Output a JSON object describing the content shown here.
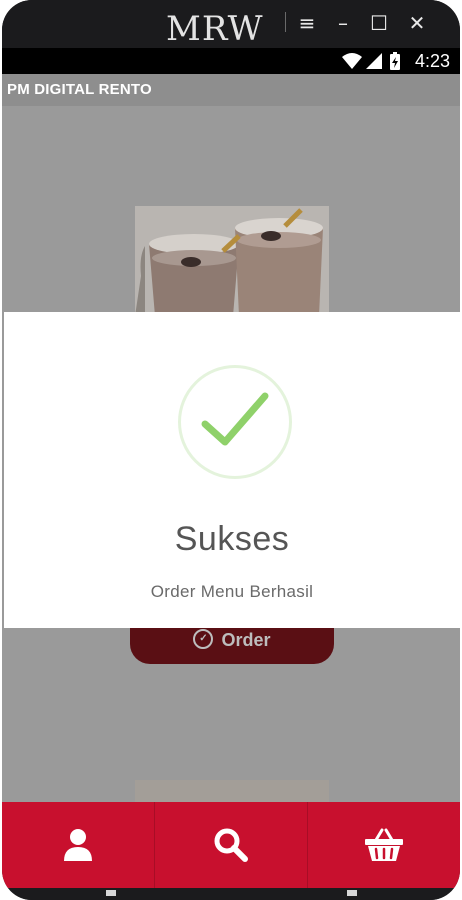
{
  "emulator": {
    "logo": "MRW",
    "controls": {
      "menu": "≡",
      "minimize": "–",
      "maximize": "☐",
      "close": "✕"
    }
  },
  "status_bar": {
    "time": "4:23",
    "icons": [
      "wifi-icon",
      "signal-icon",
      "battery-charging-icon"
    ]
  },
  "app_bar": {
    "title": "PM DIGITAL RENTO"
  },
  "menu": {
    "order_button_label": "Order"
  },
  "dialog": {
    "title": "Sukses",
    "message": "Order Menu Berhasil",
    "icon": "check-icon",
    "check_color": "#8fd16a"
  },
  "bottom_nav": {
    "items": [
      {
        "icon": "user-icon"
      },
      {
        "icon": "search-icon"
      },
      {
        "icon": "basket-icon"
      }
    ],
    "background": "#c8102e"
  }
}
